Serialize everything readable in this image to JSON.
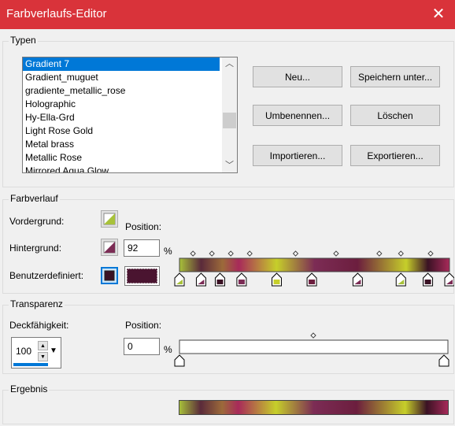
{
  "window": {
    "title": "Farbverlaufs-Editor",
    "close_glyph": "✕"
  },
  "types": {
    "label": "Typen",
    "items": [
      "Gradient 7",
      "Gradient_muguet",
      "gradiente_metallic_rose",
      "Holographic",
      "Hy-Ella-Grd",
      "Light Rose Gold",
      "Metal brass",
      "Metallic Rose",
      "Mirrored Aqua Glow"
    ],
    "selected_index": 0,
    "buttons": {
      "new": "Neu...",
      "save_as": "Speichern unter...",
      "rename": "Umbenennen...",
      "delete": "Löschen",
      "import": "Importieren...",
      "export": "Exportieren..."
    }
  },
  "gradient": {
    "label": "Farbverlauf",
    "foreground_label": "Vordergrund:",
    "background_label": "Hintergrund:",
    "custom_label": "Benutzerdefiniert:",
    "position_label": "Position:",
    "position_value": "92",
    "percent": "%",
    "colors": {
      "yellow_green": "#a8c23a",
      "plum": "#7c2c55",
      "dark": "#3a1224",
      "lime": "#c6cf2a"
    }
  },
  "transparency": {
    "label": "Transparenz",
    "opacity_label": "Deckfähigkeit:",
    "opacity_value": "100",
    "position_label": "Position:",
    "position_value": "0",
    "percent": "%"
  },
  "result": {
    "label": "Ergebnis"
  }
}
